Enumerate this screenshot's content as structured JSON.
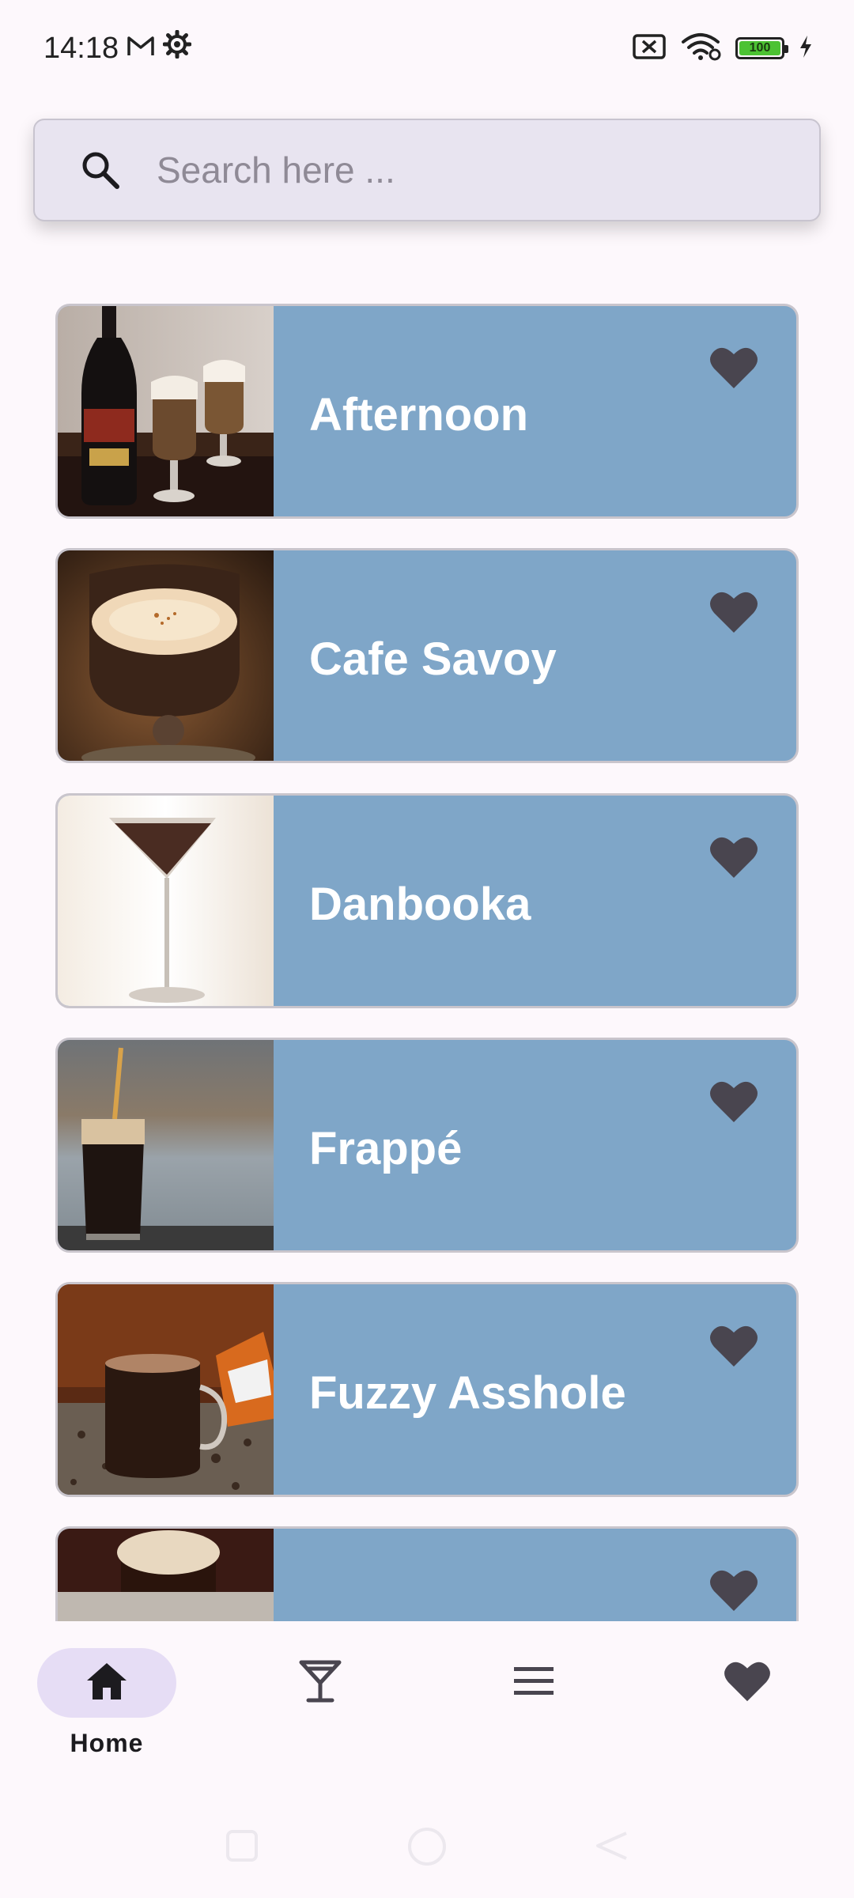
{
  "status_bar": {
    "time": "14:18",
    "battery_level": "100",
    "icons": [
      "gmail-icon",
      "settings-gear-icon",
      "sim-off-icon",
      "wifi-icon",
      "battery-icon",
      "charging-bolt-icon"
    ]
  },
  "search": {
    "placeholder": "Search here ...",
    "value": ""
  },
  "drinks": [
    {
      "name": "Afternoon",
      "favorite_icon": "heart-icon"
    },
    {
      "name": "Cafe Savoy",
      "favorite_icon": "heart-icon"
    },
    {
      "name": "Danbooka",
      "favorite_icon": "heart-icon"
    },
    {
      "name": "Frappé",
      "favorite_icon": "heart-icon"
    },
    {
      "name": "Fuzzy Asshole",
      "favorite_icon": "heart-icon"
    },
    {
      "name": "",
      "favorite_icon": "heart-icon"
    }
  ],
  "bottom_nav": {
    "items": [
      {
        "id": "home",
        "label": "Home",
        "icon": "home-icon",
        "active": true
      },
      {
        "id": "cocktails",
        "label": "",
        "icon": "cocktail-glass-icon",
        "active": false
      },
      {
        "id": "menu",
        "label": "",
        "icon": "menu-icon",
        "active": false
      },
      {
        "id": "favorites",
        "label": "",
        "icon": "heart-icon",
        "active": false
      }
    ]
  },
  "colors": {
    "background": "#fdf8fc",
    "card": "#7fa6c8",
    "heart": "#49454f",
    "nav_active_pill": "#e6ddf5",
    "search_bg": "#e8e4f0"
  }
}
